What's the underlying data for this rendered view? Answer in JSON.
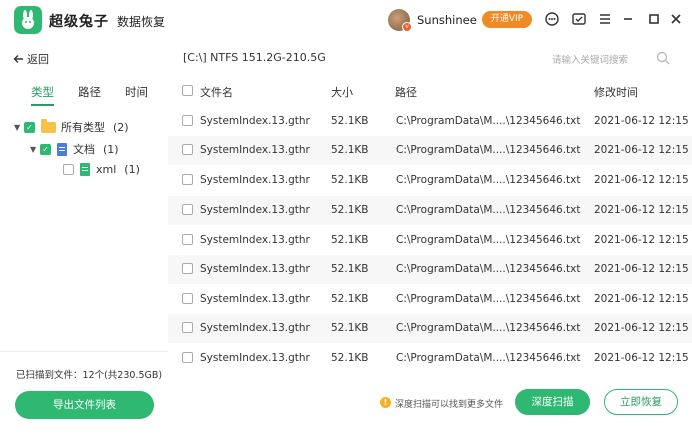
{
  "app": {
    "brand": "超级兔子",
    "subtitle": "数据恢复"
  },
  "user": {
    "name": "Sunshinee",
    "vip_label": "开通VIP"
  },
  "window_controls": [
    "support-icon",
    "feedback-icon",
    "menu-icon",
    "minimize-icon",
    "maximize-icon",
    "close-icon"
  ],
  "nav": {
    "back_label": "返回",
    "tabs": [
      "类型",
      "路径",
      "时间"
    ],
    "active_tab": 0
  },
  "tree": [
    {
      "label": "所有类型",
      "count": "(2)",
      "icon": "folder-icon"
    },
    {
      "label": "文档",
      "count": "(1)",
      "icon": "document-icon"
    },
    {
      "label": "xml",
      "count": "(1)",
      "icon": "xml-file-icon"
    }
  ],
  "scan_summary": "已扫描到文件：12个(共230.5GB)",
  "export_label": "导出文件列表",
  "path": "[C:\\] NTFS 151.2G-210.5G",
  "search": {
    "placeholder": "请输入关键词搜索"
  },
  "table": {
    "columns": [
      "文件名",
      "大小",
      "路径",
      "修改时间"
    ],
    "rows": [
      {
        "name": "SystemIndex.13.gthr",
        "size": "52.1KB",
        "path": "C:\\ProgramData\\M....\\12345646.txt",
        "modified": "2021-06-12 12:15"
      },
      {
        "name": "SystemIndex.13.gthr",
        "size": "52.1KB",
        "path": "C:\\ProgramData\\M....\\12345646.txt",
        "modified": "2021-06-12 12:15"
      },
      {
        "name": "SystemIndex.13.gthr",
        "size": "52.1KB",
        "path": "C:\\ProgramData\\M....\\12345646.txt",
        "modified": "2021-06-12 12:15"
      },
      {
        "name": "SystemIndex.13.gthr",
        "size": "52.1KB",
        "path": "C:\\ProgramData\\M....\\12345646.txt",
        "modified": "2021-06-12 12:15"
      },
      {
        "name": "SystemIndex.13.gthr",
        "size": "52.1KB",
        "path": "C:\\ProgramData\\M....\\12345646.txt",
        "modified": "2021-06-12 12:15"
      },
      {
        "name": "SystemIndex.13.gthr",
        "size": "52.1KB",
        "path": "C:\\ProgramData\\M....\\12345646.txt",
        "modified": "2021-06-12 12:15"
      },
      {
        "name": "SystemIndex.13.gthr",
        "size": "52.1KB",
        "path": "C:\\ProgramData\\M....\\12345646.txt",
        "modified": "2021-06-12 12:15"
      },
      {
        "name": "SystemIndex.13.gthr",
        "size": "52.1KB",
        "path": "C:\\ProgramData\\M....\\12345646.txt",
        "modified": "2021-06-12 12:15"
      },
      {
        "name": "SystemIndex.13.gthr",
        "size": "52.1KB",
        "path": "C:\\ProgramData\\M....\\12345646.txt",
        "modified": "2021-06-12 12:15"
      }
    ]
  },
  "footer": {
    "hint": "深度扫描可以找到更多文件",
    "deep_scan_label": "深度扫描",
    "recover_label": "立即恢复"
  },
  "colors": {
    "accent": "#2eb872",
    "vip": "#f08a24",
    "folder": "#f5c24a",
    "doc": "#4a7be0"
  }
}
